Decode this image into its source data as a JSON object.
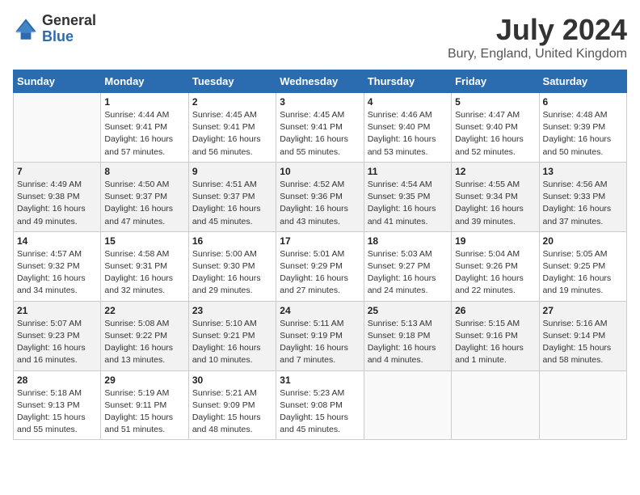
{
  "header": {
    "logo_general": "General",
    "logo_blue": "Blue",
    "month_title": "July 2024",
    "location": "Bury, England, United Kingdom"
  },
  "columns": [
    "Sunday",
    "Monday",
    "Tuesday",
    "Wednesday",
    "Thursday",
    "Friday",
    "Saturday"
  ],
  "weeks": [
    [
      {
        "day": "",
        "info": ""
      },
      {
        "day": "1",
        "info": "Sunrise: 4:44 AM\nSunset: 9:41 PM\nDaylight: 16 hours\nand 57 minutes."
      },
      {
        "day": "2",
        "info": "Sunrise: 4:45 AM\nSunset: 9:41 PM\nDaylight: 16 hours\nand 56 minutes."
      },
      {
        "day": "3",
        "info": "Sunrise: 4:45 AM\nSunset: 9:41 PM\nDaylight: 16 hours\nand 55 minutes."
      },
      {
        "day": "4",
        "info": "Sunrise: 4:46 AM\nSunset: 9:40 PM\nDaylight: 16 hours\nand 53 minutes."
      },
      {
        "day": "5",
        "info": "Sunrise: 4:47 AM\nSunset: 9:40 PM\nDaylight: 16 hours\nand 52 minutes."
      },
      {
        "day": "6",
        "info": "Sunrise: 4:48 AM\nSunset: 9:39 PM\nDaylight: 16 hours\nand 50 minutes."
      }
    ],
    [
      {
        "day": "7",
        "info": "Sunrise: 4:49 AM\nSunset: 9:38 PM\nDaylight: 16 hours\nand 49 minutes."
      },
      {
        "day": "8",
        "info": "Sunrise: 4:50 AM\nSunset: 9:37 PM\nDaylight: 16 hours\nand 47 minutes."
      },
      {
        "day": "9",
        "info": "Sunrise: 4:51 AM\nSunset: 9:37 PM\nDaylight: 16 hours\nand 45 minutes."
      },
      {
        "day": "10",
        "info": "Sunrise: 4:52 AM\nSunset: 9:36 PM\nDaylight: 16 hours\nand 43 minutes."
      },
      {
        "day": "11",
        "info": "Sunrise: 4:54 AM\nSunset: 9:35 PM\nDaylight: 16 hours\nand 41 minutes."
      },
      {
        "day": "12",
        "info": "Sunrise: 4:55 AM\nSunset: 9:34 PM\nDaylight: 16 hours\nand 39 minutes."
      },
      {
        "day": "13",
        "info": "Sunrise: 4:56 AM\nSunset: 9:33 PM\nDaylight: 16 hours\nand 37 minutes."
      }
    ],
    [
      {
        "day": "14",
        "info": "Sunrise: 4:57 AM\nSunset: 9:32 PM\nDaylight: 16 hours\nand 34 minutes."
      },
      {
        "day": "15",
        "info": "Sunrise: 4:58 AM\nSunset: 9:31 PM\nDaylight: 16 hours\nand 32 minutes."
      },
      {
        "day": "16",
        "info": "Sunrise: 5:00 AM\nSunset: 9:30 PM\nDaylight: 16 hours\nand 29 minutes."
      },
      {
        "day": "17",
        "info": "Sunrise: 5:01 AM\nSunset: 9:29 PM\nDaylight: 16 hours\nand 27 minutes."
      },
      {
        "day": "18",
        "info": "Sunrise: 5:03 AM\nSunset: 9:27 PM\nDaylight: 16 hours\nand 24 minutes."
      },
      {
        "day": "19",
        "info": "Sunrise: 5:04 AM\nSunset: 9:26 PM\nDaylight: 16 hours\nand 22 minutes."
      },
      {
        "day": "20",
        "info": "Sunrise: 5:05 AM\nSunset: 9:25 PM\nDaylight: 16 hours\nand 19 minutes."
      }
    ],
    [
      {
        "day": "21",
        "info": "Sunrise: 5:07 AM\nSunset: 9:23 PM\nDaylight: 16 hours\nand 16 minutes."
      },
      {
        "day": "22",
        "info": "Sunrise: 5:08 AM\nSunset: 9:22 PM\nDaylight: 16 hours\nand 13 minutes."
      },
      {
        "day": "23",
        "info": "Sunrise: 5:10 AM\nSunset: 9:21 PM\nDaylight: 16 hours\nand 10 minutes."
      },
      {
        "day": "24",
        "info": "Sunrise: 5:11 AM\nSunset: 9:19 PM\nDaylight: 16 hours\nand 7 minutes."
      },
      {
        "day": "25",
        "info": "Sunrise: 5:13 AM\nSunset: 9:18 PM\nDaylight: 16 hours\nand 4 minutes."
      },
      {
        "day": "26",
        "info": "Sunrise: 5:15 AM\nSunset: 9:16 PM\nDaylight: 16 hours\nand 1 minute."
      },
      {
        "day": "27",
        "info": "Sunrise: 5:16 AM\nSunset: 9:14 PM\nDaylight: 15 hours\nand 58 minutes."
      }
    ],
    [
      {
        "day": "28",
        "info": "Sunrise: 5:18 AM\nSunset: 9:13 PM\nDaylight: 15 hours\nand 55 minutes."
      },
      {
        "day": "29",
        "info": "Sunrise: 5:19 AM\nSunset: 9:11 PM\nDaylight: 15 hours\nand 51 minutes."
      },
      {
        "day": "30",
        "info": "Sunrise: 5:21 AM\nSunset: 9:09 PM\nDaylight: 15 hours\nand 48 minutes."
      },
      {
        "day": "31",
        "info": "Sunrise: 5:23 AM\nSunset: 9:08 PM\nDaylight: 15 hours\nand 45 minutes."
      },
      {
        "day": "",
        "info": ""
      },
      {
        "day": "",
        "info": ""
      },
      {
        "day": "",
        "info": ""
      }
    ]
  ]
}
